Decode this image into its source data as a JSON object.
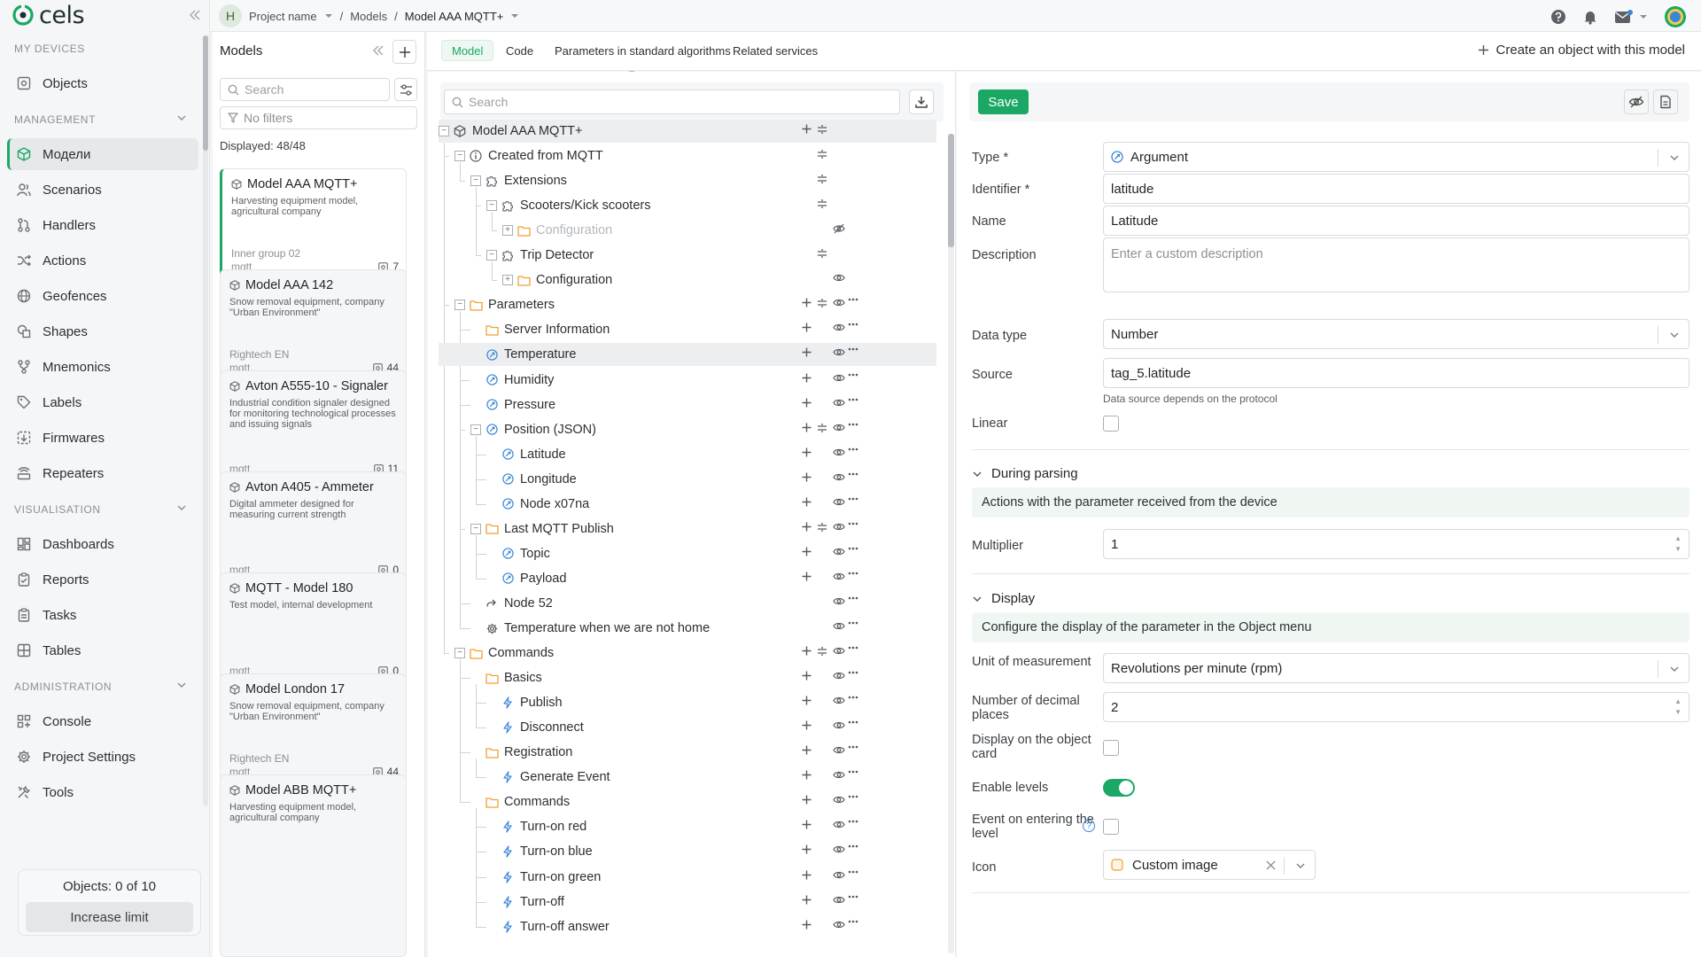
{
  "app": {
    "logo_text": "cels"
  },
  "breadcrumb": {
    "project_initial": "H",
    "project_name": "Project name",
    "sep1": "/",
    "models": "Models",
    "sep2": "/",
    "current_model": "Model AAA MQTT+"
  },
  "sidebar": {
    "sections": [
      {
        "title": "MY DEVICES"
      },
      {
        "title": "MANAGEMENT"
      },
      {
        "title": "VISUALISATION"
      },
      {
        "title": "ADMINISTRATION"
      }
    ],
    "items": [
      {
        "label": "Objects",
        "icon": "objects-icon"
      },
      {
        "label": "Модели",
        "icon": "cube-icon",
        "active": true
      },
      {
        "label": "Scenarios",
        "icon": "users-icon"
      },
      {
        "label": "Handlers",
        "icon": "handlers-icon"
      },
      {
        "label": "Actions",
        "icon": "shuffle-icon"
      },
      {
        "label": "Geofences",
        "icon": "globe-icon"
      },
      {
        "label": "Shapes",
        "icon": "shapes-icon"
      },
      {
        "label": "Mnemonics",
        "icon": "mnemonics-icon"
      },
      {
        "label": "Labels",
        "icon": "tag-icon"
      },
      {
        "label": "Firmwares",
        "icon": "firmware-icon"
      },
      {
        "label": "Repeaters",
        "icon": "repeater-icon"
      },
      {
        "label": "Dashboards",
        "icon": "dashboard-icon"
      },
      {
        "label": "Reports",
        "icon": "clipboard-icon"
      },
      {
        "label": "Tasks",
        "icon": "tasks-icon"
      },
      {
        "label": "Tables",
        "icon": "table-icon"
      },
      {
        "label": "Console",
        "icon": "console-icon"
      },
      {
        "label": "Project Settings",
        "icon": "gear-icon"
      },
      {
        "label": "Tools",
        "icon": "tools-icon"
      }
    ],
    "objects_limit": "Objects: 0 of 10",
    "increase_limit": "Increase limit"
  },
  "models_panel": {
    "title": "Models",
    "search_placeholder": "Search",
    "no_filters": "No filters",
    "displayed": "Displayed: 48/48",
    "cards": [
      {
        "title": "Model AAA MQTT+",
        "desc": "Harvesting equipment model, agricultural company",
        "group": "Inner group 02",
        "proto": "mqtt",
        "count": "7",
        "active": true
      },
      {
        "title": "Model AAA 142",
        "desc": "Snow removal equipment, company \"Urban Environment\"",
        "group": "Rightech EN",
        "proto": "mqtt",
        "count": "44"
      },
      {
        "title": "Avton A555-10 - Signaler",
        "desc": "Industrial condition signaler designed for monitoring technological processes and issuing signals",
        "group": "",
        "proto": "mqtt",
        "count": "11"
      },
      {
        "title": "Avton A405 - Ammeter",
        "desc": "Digital ammeter designed for measuring current strength",
        "group": "",
        "proto": "mqtt",
        "count": "0"
      },
      {
        "title": "MQTT - Model 180",
        "desc": "Test model, internal development",
        "group": "",
        "proto": "mqtt",
        "count": "0"
      },
      {
        "title": "Model London 17",
        "desc": "Snow removal equipment, company \"Urban Environment\"",
        "group": "Rightech EN",
        "proto": "mqtt",
        "count": "44"
      },
      {
        "title": "Model ABB MQTT+",
        "desc": "Harvesting equipment model, agricultural company",
        "group": "",
        "proto": "",
        "count": ""
      }
    ]
  },
  "tabs": [
    {
      "label": "Model",
      "active": true
    },
    {
      "label": "Code"
    },
    {
      "label": "Parameters in standard algorithms"
    },
    {
      "label": "Related services"
    }
  ],
  "create_object": "Create an object with this model",
  "tree": {
    "search_placeholder": "Search",
    "nodes": [
      {
        "label": "Model AAA MQTT+",
        "depth": 0,
        "icon": "cube-icon",
        "exp": "minus",
        "actions": [
          "plus",
          "drag"
        ],
        "hl": true
      },
      {
        "label": "Created from MQTT",
        "depth": 1,
        "icon": "info-icon",
        "exp": "minus",
        "actions": [
          "drag"
        ]
      },
      {
        "label": "Extensions",
        "depth": 2,
        "icon": "puzzle-icon",
        "exp": "minus",
        "actions": [
          "drag"
        ]
      },
      {
        "label": "Scooters/Kick scooters",
        "depth": 3,
        "icon": "puzzle-icon",
        "exp": "minus",
        "actions": [
          "drag"
        ]
      },
      {
        "label": "Configuration",
        "depth": 4,
        "icon": "folder-icon",
        "exp": "plus",
        "actions": [
          "eye-off"
        ],
        "dim": true
      },
      {
        "label": "Trip Detector",
        "depth": 3,
        "icon": "puzzle-icon",
        "exp": "minus",
        "actions": [
          "drag"
        ]
      },
      {
        "label": "Configuration",
        "depth": 4,
        "icon": "folder-icon",
        "exp": "plus",
        "actions": [
          "eye"
        ]
      },
      {
        "label": "Parameters",
        "depth": 1,
        "icon": "folder-icon",
        "exp": "minus",
        "actions": [
          "plus",
          "drag",
          "eye",
          "dots"
        ]
      },
      {
        "label": "Server Information",
        "depth": 2,
        "icon": "folder-icon",
        "exp": "none",
        "actions": [
          "plus",
          "eye",
          "dots"
        ]
      },
      {
        "label": "Temperature",
        "depth": 2,
        "icon": "argument-icon",
        "exp": "none",
        "actions": [
          "plus",
          "eye",
          "dots"
        ],
        "hl": true
      },
      {
        "label": "Humidity",
        "depth": 2,
        "icon": "argument-icon",
        "exp": "none",
        "actions": [
          "plus",
          "eye",
          "dots"
        ]
      },
      {
        "label": "Pressure",
        "depth": 2,
        "icon": "argument-icon",
        "exp": "none",
        "actions": [
          "plus",
          "eye",
          "dots"
        ]
      },
      {
        "label": "Position (JSON)",
        "depth": 2,
        "icon": "argument-icon",
        "exp": "minus",
        "actions": [
          "plus",
          "drag",
          "eye",
          "dots"
        ]
      },
      {
        "label": "Latitude",
        "depth": 3,
        "icon": "argument-icon",
        "exp": "none",
        "actions": [
          "plus",
          "eye",
          "dots"
        ]
      },
      {
        "label": "Longitude",
        "depth": 3,
        "icon": "argument-icon",
        "exp": "none",
        "actions": [
          "plus",
          "eye",
          "dots"
        ]
      },
      {
        "label": "Node x07na",
        "depth": 3,
        "icon": "argument-icon",
        "exp": "none",
        "actions": [
          "plus",
          "eye",
          "dots"
        ]
      },
      {
        "label": "Last MQTT Publish",
        "depth": 2,
        "icon": "folder-icon",
        "exp": "minus",
        "actions": [
          "plus",
          "drag",
          "eye",
          "dots"
        ]
      },
      {
        "label": "Topic",
        "depth": 3,
        "icon": "argument-icon",
        "exp": "none",
        "actions": [
          "plus",
          "eye",
          "dots"
        ]
      },
      {
        "label": "Payload",
        "depth": 3,
        "icon": "argument-icon",
        "exp": "none",
        "actions": [
          "plus",
          "eye",
          "dots"
        ]
      },
      {
        "label": "Node 52",
        "depth": 2,
        "icon": "link-icon",
        "exp": "none",
        "actions": [
          "eye",
          "dots"
        ]
      },
      {
        "label": "Temperature when we are not home",
        "depth": 2,
        "icon": "gear-icon",
        "exp": "none",
        "actions": [
          "eye",
          "dots"
        ]
      },
      {
        "label": "Commands",
        "depth": 1,
        "icon": "folder-icon",
        "exp": "minus",
        "actions": [
          "plus",
          "drag",
          "eye",
          "dots"
        ]
      },
      {
        "label": "Basics",
        "depth": 2,
        "icon": "folder-icon",
        "exp": "none",
        "actions": [
          "plus",
          "eye",
          "dots"
        ]
      },
      {
        "label": "Publish",
        "depth": 3,
        "icon": "bolt-icon",
        "exp": "none",
        "actions": [
          "plus",
          "eye",
          "dots"
        ]
      },
      {
        "label": "Disconnect",
        "depth": 3,
        "icon": "bolt-icon",
        "exp": "none",
        "actions": [
          "plus",
          "eye",
          "dots"
        ]
      },
      {
        "label": "Registration",
        "depth": 2,
        "icon": "folder-icon",
        "exp": "none",
        "actions": [
          "plus",
          "eye",
          "dots"
        ]
      },
      {
        "label": "Generate Event",
        "depth": 3,
        "icon": "bolt-icon",
        "exp": "none",
        "actions": [
          "plus",
          "eye",
          "dots"
        ]
      },
      {
        "label": "Commands",
        "depth": 2,
        "icon": "folder-icon",
        "exp": "none",
        "actions": [
          "plus",
          "eye",
          "dots"
        ]
      },
      {
        "label": "Turn-on red",
        "depth": 3,
        "icon": "bolt-icon",
        "exp": "none",
        "actions": [
          "plus",
          "eye",
          "dots"
        ]
      },
      {
        "label": "Turn-on blue",
        "depth": 3,
        "icon": "bolt-icon",
        "exp": "none",
        "actions": [
          "plus",
          "eye",
          "dots"
        ]
      },
      {
        "label": "Turn-on green",
        "depth": 3,
        "icon": "bolt-icon",
        "exp": "none",
        "actions": [
          "plus",
          "eye",
          "dots"
        ]
      },
      {
        "label": "Turn-off",
        "depth": 3,
        "icon": "bolt-icon",
        "exp": "none",
        "actions": [
          "plus",
          "eye",
          "dots"
        ]
      },
      {
        "label": "Turn-off answer",
        "depth": 3,
        "icon": "bolt-icon",
        "exp": "none",
        "actions": [
          "plus",
          "eye",
          "dots"
        ]
      }
    ]
  },
  "props": {
    "save": "Save",
    "type_label": "Type *",
    "type_value": "Argument",
    "identifier_label": "Identifier *",
    "identifier_value": "latitude",
    "name_label": "Name",
    "name_value": "Latitude",
    "description_label": "Description",
    "description_placeholder": "Enter a custom description",
    "datatype_label": "Data type",
    "datatype_value": "Number",
    "source_label": "Source",
    "source_value": "tag_5.latitude",
    "source_hint": "Data source depends on the protocol",
    "linear_label": "Linear",
    "parsing_title": "During parsing",
    "parsing_info": "Actions with the parameter received from the device",
    "multiplier_label": "Multiplier",
    "multiplier_value": "1",
    "display_title": "Display",
    "display_info": "Configure the display of the parameter in the Object menu",
    "unit_label": "Unit of measurement",
    "unit_value": "Revolutions per minute (rpm)",
    "decimals_label": "Number of decimal places",
    "decimals_value": "2",
    "card_label": "Display on the object card",
    "levels_label": "Enable levels",
    "levels_enabled": true,
    "event_label": "Event on entering the level",
    "help_char": "?",
    "icon_label": "Icon",
    "icon_value": "Custom image"
  },
  "colors": {
    "accent": "#1aa864",
    "argument_blue": "#3a86d9",
    "folder_orange": "#f0a030"
  }
}
